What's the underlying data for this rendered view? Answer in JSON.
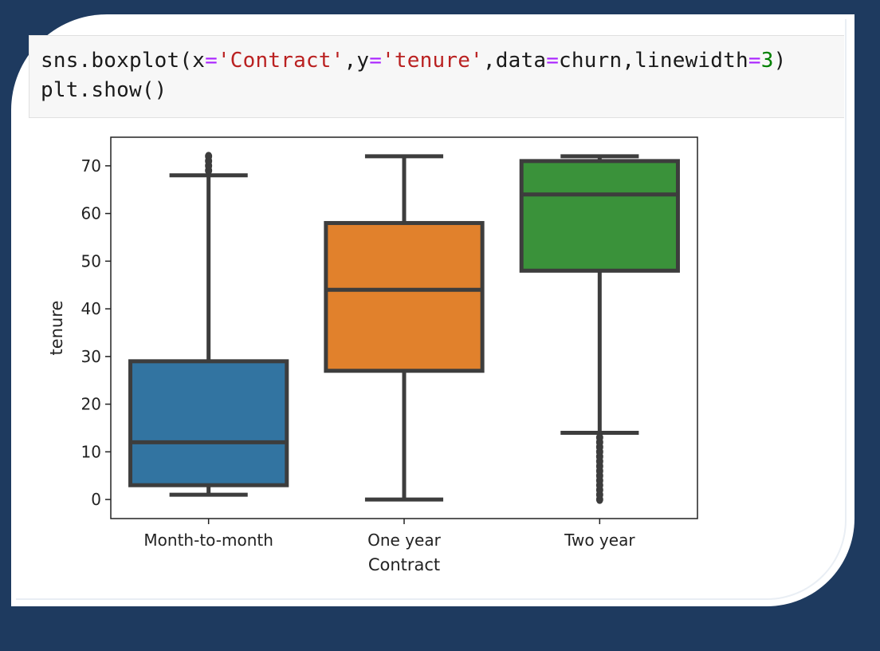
{
  "code": {
    "line1_parts": [
      {
        "t": "sns.boxplot(x",
        "c": ""
      },
      {
        "t": "=",
        "c": "op"
      },
      {
        "t": "'Contract'",
        "c": "str"
      },
      {
        "t": ",y",
        "c": ""
      },
      {
        "t": "=",
        "c": "op"
      },
      {
        "t": "'tenure'",
        "c": "str"
      },
      {
        "t": ",data",
        "c": ""
      },
      {
        "t": "=",
        "c": "op"
      },
      {
        "t": "churn,linewidth",
        "c": ""
      },
      {
        "t": "=",
        "c": "op"
      },
      {
        "t": "3",
        "c": "num"
      },
      {
        "t": ")",
        "c": ""
      }
    ],
    "line2": "plt.show()"
  },
  "chart_data": {
    "type": "box",
    "xlabel": "Contract",
    "ylabel": "tenure",
    "ylim": [
      -4,
      76
    ],
    "yticks": [
      0,
      10,
      20,
      30,
      40,
      50,
      60,
      70
    ],
    "categories": [
      "Month-to-month",
      "One year",
      "Two year"
    ],
    "boxes": [
      {
        "category": "Month-to-month",
        "whisker_low": 1,
        "q1": 3,
        "median": 12,
        "q3": 29,
        "whisker_high": 68,
        "outliers": [
          69,
          70,
          71,
          72
        ],
        "color": "#3274a1"
      },
      {
        "category": "One year",
        "whisker_low": 0,
        "q1": 27,
        "median": 44,
        "q3": 58,
        "whisker_high": 72,
        "outliers": [],
        "color": "#e1812c"
      },
      {
        "category": "Two year",
        "whisker_low": 14,
        "q1": 48,
        "median": 64,
        "q3": 71,
        "whisker_high": 72,
        "outliers": [
          0,
          1,
          2,
          3,
          4,
          5,
          6,
          7,
          8,
          9,
          10,
          11,
          12,
          13
        ],
        "color": "#3a923a"
      }
    ],
    "line_color": "#3d3d3d",
    "grid": false,
    "legend": "none"
  }
}
